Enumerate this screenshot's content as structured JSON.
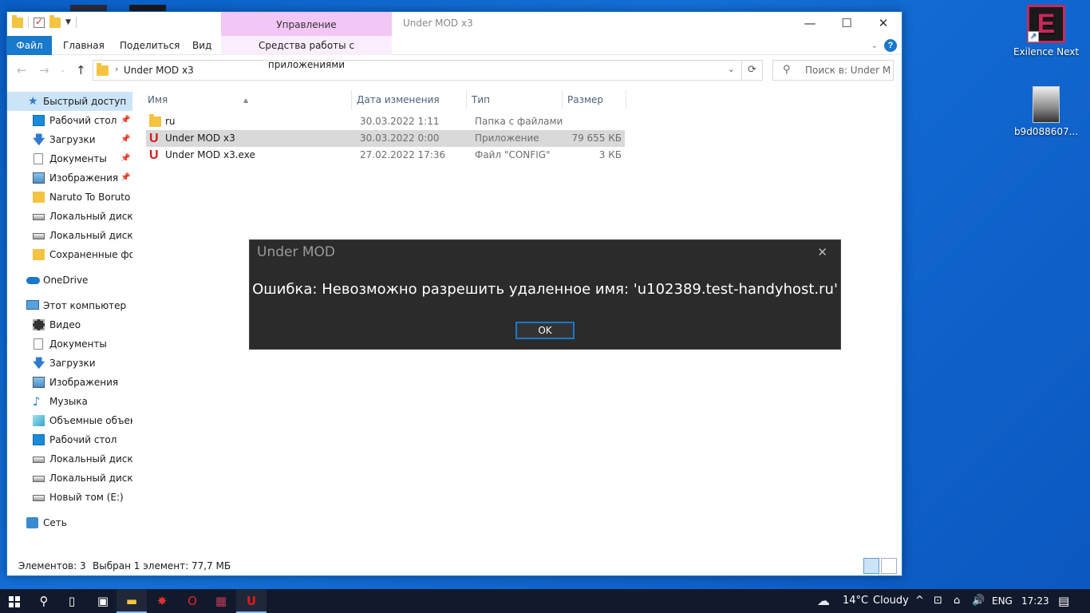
{
  "desktop": {
    "icons": [
      {
        "label": "Exilence Next"
      },
      {
        "label": "b9d088607..."
      }
    ]
  },
  "window": {
    "title": "Under MOD x3",
    "manage_tab": "Управление",
    "ribbon_tabs": {
      "file": "Файл",
      "home": "Главная",
      "share": "Поделиться",
      "view": "Вид",
      "app_tools": "Средства работы с приложениями"
    },
    "controls": {
      "minimize": "—",
      "maximize": "☐",
      "close": "✕"
    },
    "address": {
      "path": "Under MOD x3"
    },
    "search": {
      "placeholder": "Поиск в: Under M..."
    }
  },
  "sidebar": {
    "items": [
      {
        "label": "Быстрый доступ",
        "icon": "star-icon"
      },
      {
        "label": "Рабочий стол",
        "icon": "desktop-icon"
      },
      {
        "label": "Загрузки",
        "icon": "download-icon"
      },
      {
        "label": "Документы",
        "icon": "documents-icon"
      },
      {
        "label": "Изображения",
        "icon": "pictures-icon"
      },
      {
        "label": "Naruto To Boruto",
        "icon": "folder-icon"
      },
      {
        "label": "Локальный диск (C",
        "icon": "drive-icon"
      },
      {
        "label": "Локальный диск (D",
        "icon": "drive-icon"
      },
      {
        "label": "Сохраненные фото",
        "icon": "folder-icon"
      },
      {
        "label": "OneDrive",
        "icon": "onedrive-icon"
      },
      {
        "label": "Этот компьютер",
        "icon": "computer-icon"
      },
      {
        "label": "Видео",
        "icon": "video-icon"
      },
      {
        "label": "Документы",
        "icon": "documents-icon"
      },
      {
        "label": "Загрузки",
        "icon": "download-icon"
      },
      {
        "label": "Изображения",
        "icon": "pictures-icon"
      },
      {
        "label": "Музыка",
        "icon": "music-icon"
      },
      {
        "label": "Объемные объекты",
        "icon": "3d-objects-icon"
      },
      {
        "label": "Рабочий стол",
        "icon": "desktop-icon"
      },
      {
        "label": "Локальный диск (C",
        "icon": "drive-icon"
      },
      {
        "label": "Локальный диск (D",
        "icon": "drive-icon"
      },
      {
        "label": "Новый том (E:)",
        "icon": "drive-icon"
      },
      {
        "label": "Сеть",
        "icon": "network-icon"
      }
    ]
  },
  "table": {
    "columns": {
      "name": "Имя",
      "date": "Дата изменения",
      "type": "Тип",
      "size": "Размер"
    },
    "rows": [
      {
        "name": "ru",
        "date": "30.03.2022 1:11",
        "type": "Папка с файлами",
        "size": ""
      },
      {
        "name": "Under MOD x3",
        "date": "30.03.2022 0:00",
        "type": "Приложение",
        "size": "79 655 КБ"
      },
      {
        "name": "Under MOD x3.exe",
        "date": "27.02.2022 17:36",
        "type": "Файл \"CONFIG\"",
        "size": "3 КБ"
      }
    ]
  },
  "status": {
    "count": "Элементов: 3",
    "selection": "Выбран 1 элемент: 77,7 МБ"
  },
  "dialog": {
    "title": "Under MOD",
    "message": "Ошибка: Невозможно разрешить удаленное имя: 'u102389.test-handyhost.ru'",
    "ok": "OK"
  },
  "taskbar": {
    "weather": "14°C",
    "weather_text": "Cloudy",
    "language": "ENG",
    "time": "17:23"
  }
}
